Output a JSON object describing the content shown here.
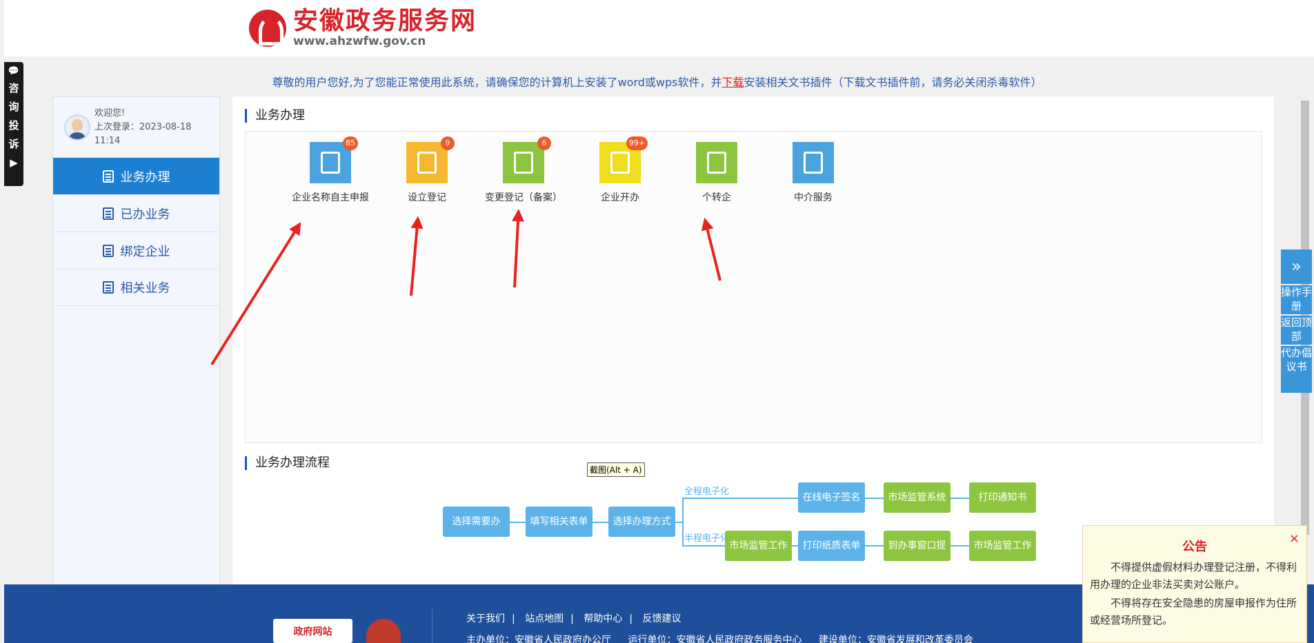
{
  "site": {
    "title": "安徽政务服务网",
    "url": "www.ahzwfw.gov.cn"
  },
  "left_tab": {
    "chars": [
      "咨",
      "询",
      "投",
      "诉"
    ],
    "arrow": "▶"
  },
  "notice": {
    "prefix": "尊敬的用户您好,为了您能正常使用此系统，请确保您的计算机上安装了word或wps软件，并",
    "link": "下载",
    "suffix": "安装相关文书插件（下载文书插件前，请务必关闭杀毒软件）"
  },
  "user": {
    "welcome": "欢迎您!",
    "last_login": "上次登录：2023-08-18 11:14"
  },
  "nav": {
    "items": [
      {
        "label": "业务办理",
        "icon": "edit-doc-icon"
      },
      {
        "label": "已办业务",
        "icon": "doc-check-icon"
      },
      {
        "label": "绑定企业",
        "icon": "building-icon"
      },
      {
        "label": "相关业务",
        "icon": "doc-search-icon"
      }
    ]
  },
  "business": {
    "title": "业务办理",
    "services": [
      {
        "label": "企业名称自主申报",
        "badge": "85",
        "color": "#4aa3df",
        "icon": "building-icon"
      },
      {
        "label": "设立登记",
        "badge": "9",
        "color": "#f5b82e",
        "icon": "clipboard-icon"
      },
      {
        "label": "变更登记（备案）",
        "badge": "6",
        "color": "#8cc63f",
        "icon": "clipboard-refresh-icon"
      },
      {
        "label": "企业开办",
        "badge": "99+",
        "color": "#f0dd1e",
        "icon": "merge-icon"
      },
      {
        "label": "个转企",
        "badge": "",
        "color": "#8cc63f",
        "icon": "clipboard-refresh-icon"
      },
      {
        "label": "中介服务",
        "badge": "",
        "color": "#4aa3df",
        "icon": "id-card-icon"
      }
    ]
  },
  "tooltip": "截图(Alt + A)",
  "flow": {
    "title": "业务办理流程",
    "steps": [
      "选择需要办",
      "填写相关表单",
      "选择办理方式"
    ],
    "branch_full_label": "全程电子化",
    "branch_half_label": "半程电子化",
    "full": [
      "在线电子签名",
      "市场监管系统",
      "打印通知书"
    ],
    "half": [
      "市场监管工作",
      "打印纸质表单",
      "到办事窗口提",
      "市场监管工作"
    ]
  },
  "side_tools": [
    {
      "label": "操作手册"
    },
    {
      "label": "返回顶部"
    },
    {
      "label": "代办倡议书"
    }
  ],
  "footer": {
    "gov_logo": "政府网站",
    "links": [
      "关于我们",
      "站点地图",
      "帮助中心",
      "反馈建议"
    ],
    "host": "主办单位：安徽省人民政府办公厅",
    "operator": "运行单位：安徽省人民政府政务服务中心",
    "builder": "建设单位：安徽省发展和改革委员会"
  },
  "announcement": {
    "title": "公告",
    "close": "×",
    "p1": "不得提供虚假材料办理登记注册，不得利用办理的企业非法买卖对公账户。",
    "p2": "不得将存在安全隐患的房屋申报作为住所或经营场所登记。"
  }
}
